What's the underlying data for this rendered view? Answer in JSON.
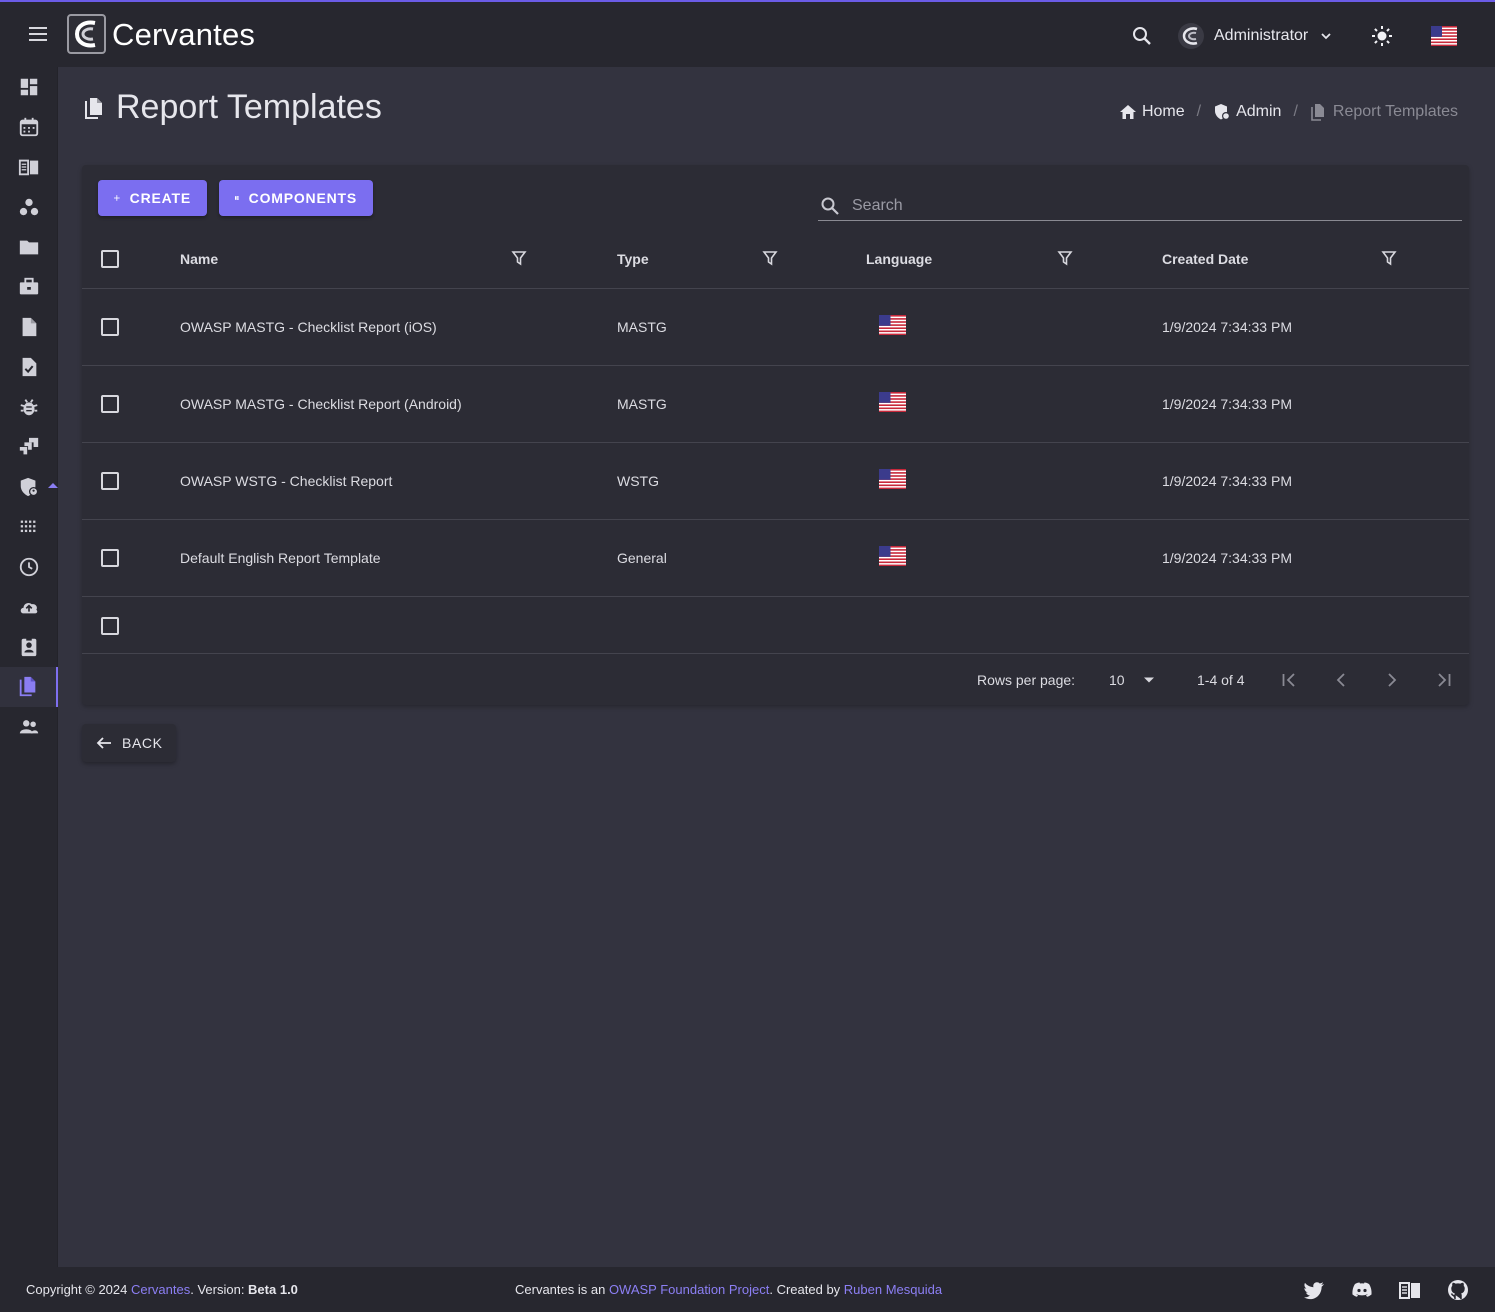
{
  "app": {
    "brand": "Cervantes",
    "user_name": "Administrator"
  },
  "page": {
    "title": "Report Templates"
  },
  "breadcrumb": [
    {
      "label": "Home"
    },
    {
      "label": "Admin"
    },
    {
      "label": "Report Templates"
    }
  ],
  "toolbar": {
    "create_label": "CREATE",
    "components_label": "COMPONENTS",
    "search_placeholder": "Search"
  },
  "table": {
    "columns": [
      "Name",
      "Type",
      "Language",
      "Created Date"
    ],
    "rows": [
      {
        "name": "OWASP MASTG - Checklist Report (iOS)",
        "type": "MASTG",
        "language": "us-flag",
        "created": "1/9/2024 7:34:33 PM"
      },
      {
        "name": "OWASP MASTG - Checklist Report (Android)",
        "type": "MASTG",
        "language": "us-flag",
        "created": "1/9/2024 7:34:33 PM"
      },
      {
        "name": "OWASP WSTG - Checklist Report",
        "type": "WSTG",
        "language": "us-flag",
        "created": "1/9/2024 7:34:33 PM"
      },
      {
        "name": "Default English Report Template",
        "type": "General",
        "language": "us-flag",
        "created": "1/9/2024 7:34:33 PM"
      }
    ]
  },
  "pagination": {
    "rows_per_page_label": "Rows per page:",
    "rows_per_page": "10",
    "range": "1-4 of 4"
  },
  "back_label": "BACK",
  "footer": {
    "copyright": "Copyright © 2024 ",
    "brand_link": "Cervantes",
    "version_prefix": ". Version: ",
    "version": "Beta 1.0",
    "about_prefix": "Cervantes is an ",
    "owasp_link": "OWASP Foundation Project",
    "created_by": ". Created by ",
    "author_link": "Ruben Mesquida"
  },
  "colors": {
    "accent": "#7b6ef0",
    "top_border": "#6b5ce7",
    "background": "#33333f",
    "surface": "#2c2c35",
    "bar": "#27272f"
  },
  "icons": {
    "sidebar": [
      "dashboard-icon",
      "calendar-icon",
      "book-icon",
      "workspaces-icon",
      "folder-icon",
      "briefcase-icon",
      "document-icon",
      "task-icon",
      "bug-icon",
      "jira-icon",
      "admin-shield-icon",
      "apps-grid-icon",
      "history-icon",
      "upload-cloud-icon",
      "contact-badge-icon",
      "report-templates-icon",
      "users-icon"
    ],
    "footer": [
      "twitter-icon",
      "discord-icon",
      "docs-book-icon",
      "github-icon"
    ]
  }
}
